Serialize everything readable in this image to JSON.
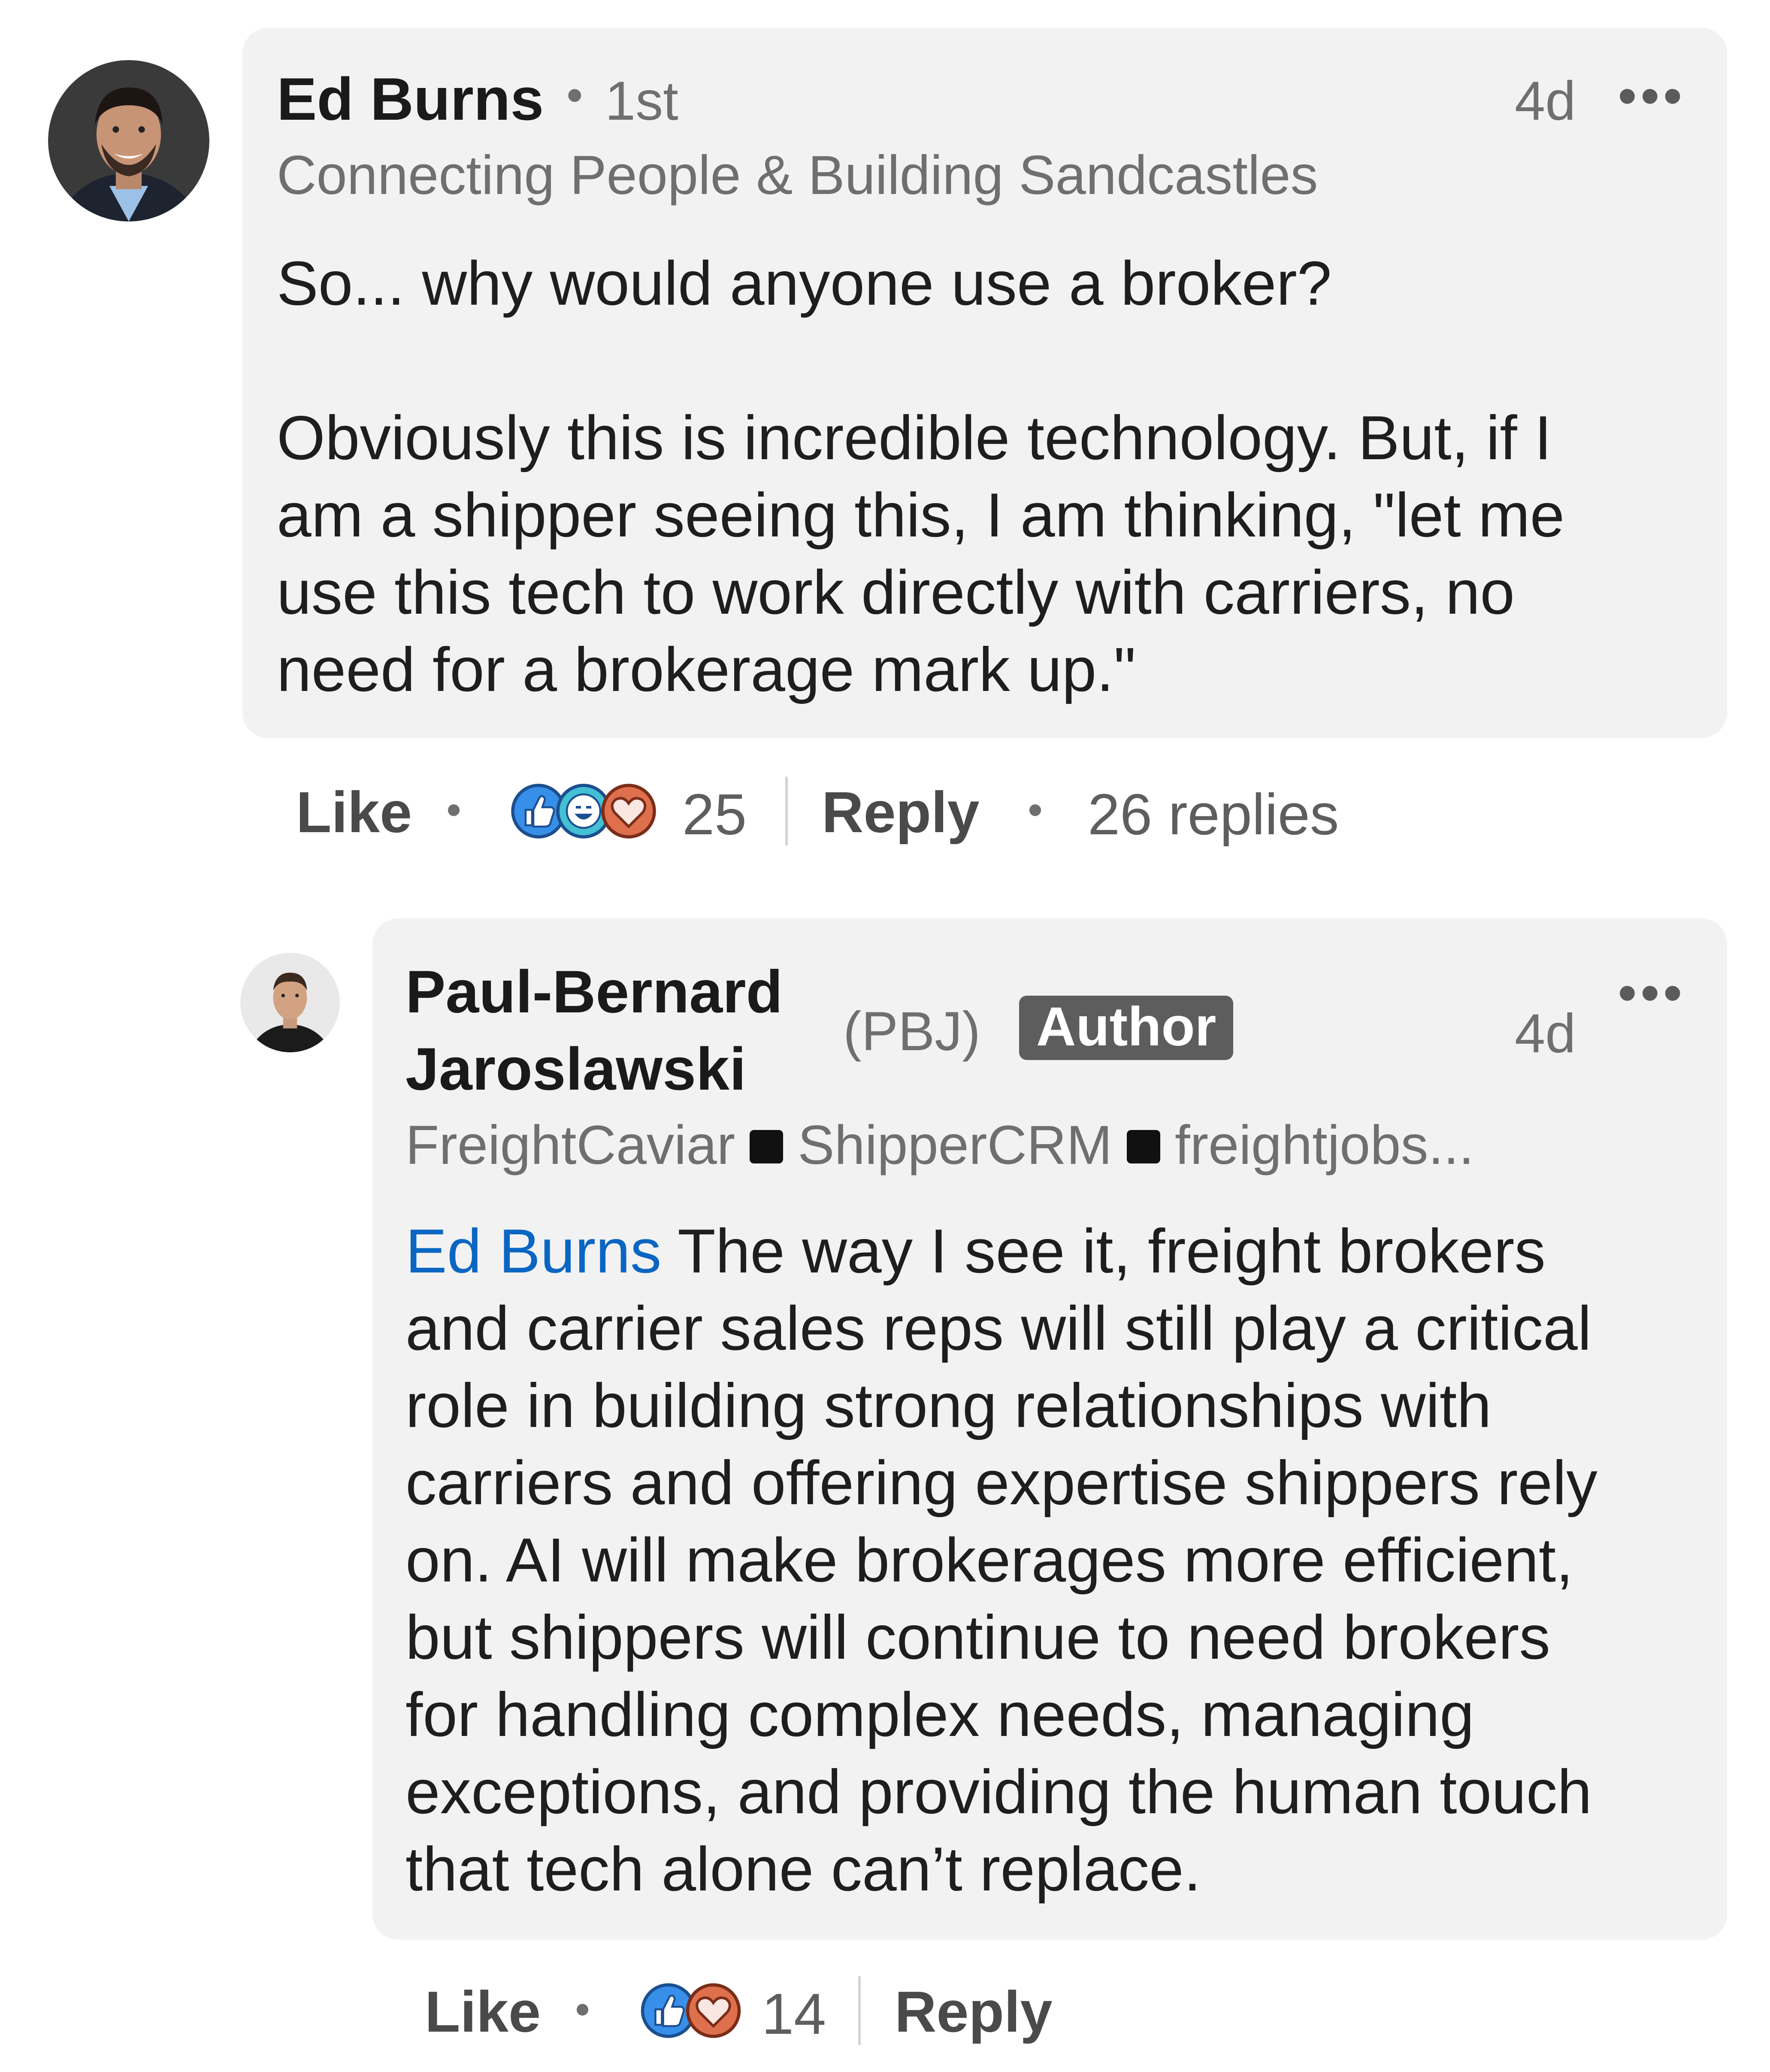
{
  "comments": [
    {
      "author": "Ed Burns",
      "degree": "1st",
      "headline": "Connecting People & Building Sandcastles",
      "time": "4d",
      "more": "•••",
      "paragraph1": "So... why would anyone use a broker?",
      "paragraph2": "Obviously this is incredible technology. But, if I\nam a shipper seeing this, I am thinking, \"let me\nuse this tech to work directly with carriers, no\nneed for a brokerage mark up.\"",
      "actions": {
        "like": "Like",
        "reaction_count": "25",
        "reply": "Reply",
        "replies": "26 replies"
      }
    },
    {
      "author_line1": "Paul-Bernard",
      "author_line2": "Jaroslawski",
      "nickname": "(PBJ)",
      "badge": "Author",
      "time": "4d",
      "more": "•••",
      "headline_parts": [
        "FreightCaviar",
        "ShipperCRM",
        "freightjobs..."
      ],
      "mention": "Ed Burns",
      "body": " The way I see it, freight brokers\nand carrier sales reps will still play a critical\nrole in building strong relationships with\ncarriers and offering expertise shippers rely\non. AI will make brokerages more efficient,\nbut shippers will continue to need brokers\nfor handling complex needs, managing\nexceptions, and providing the human touch\nthat tech alone can’t replace.",
      "actions": {
        "like": "Like",
        "reaction_count": "14",
        "reply": "Reply"
      }
    }
  ],
  "separator_dot": "•",
  "colors": {
    "bubble": "#f2f2f2",
    "mention": "#0a66c2",
    "like_blue": "#378fe9",
    "love_red": "#df704d",
    "funny_teal": "#44bfd3",
    "author_badge": "#5d5d5d"
  },
  "icons": [
    "like-reaction-icon",
    "funny-reaction-icon",
    "love-reaction-icon",
    "more-options-icon"
  ]
}
